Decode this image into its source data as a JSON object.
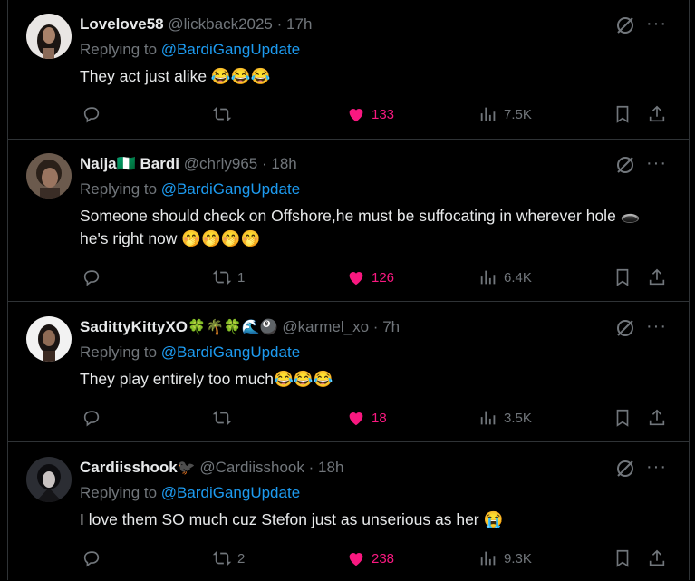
{
  "colors": {
    "background": "#000000",
    "text": "#e7e9ea",
    "muted": "#71767b",
    "link": "#1d9bf0",
    "like": "#f91880"
  },
  "replies": [
    {
      "name": "Lovelove58",
      "name_emoji": "",
      "handle": "@lickback2025",
      "time": "17h",
      "replying_prefix": "Replying to",
      "replying_to": "@BardiGangUpdate",
      "text": "They act just alike 😂😂😂",
      "retweets": "",
      "likes": "133",
      "views": "7.5K",
      "liked": true
    },
    {
      "name": "Naija🇳🇬 Bardi",
      "name_emoji": "",
      "handle": "@chrly965",
      "time": "18h",
      "replying_prefix": "Replying to",
      "replying_to": "@BardiGangUpdate",
      "text": "Someone should check on Offshore,he must be suffocating in wherever hole 🕳️ he's right now 🤭🤭🤭🤭",
      "retweets": "1",
      "likes": "126",
      "views": "6.4K",
      "liked": true
    },
    {
      "name": "SadittyKittyXO",
      "name_emoji": "🍀🌴🍀🌊🎱",
      "handle": "@karmel_xo",
      "time": "7h",
      "replying_prefix": "Replying to",
      "replying_to": "@BardiGangUpdate",
      "text": "They play entirely too much😂😂😂",
      "retweets": "",
      "likes": "18",
      "views": "3.5K",
      "liked": true
    },
    {
      "name": "Cardiisshook",
      "name_emoji": "🐦‍⬛",
      "handle": "@Cardiisshook",
      "time": "18h",
      "replying_prefix": "Replying to",
      "replying_to": "@BardiGangUpdate",
      "text": "I love them SO much cuz Stefon just as unserious as her 😭",
      "retweets": "2",
      "likes": "238",
      "views": "9.3K",
      "liked": true
    }
  ]
}
